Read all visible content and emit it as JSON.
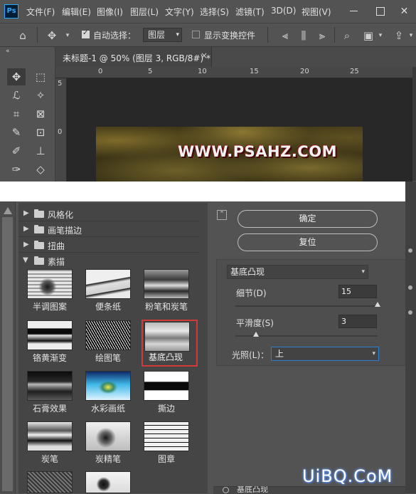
{
  "app": {
    "logo": "Ps"
  },
  "menu": [
    "文件(F)",
    "编辑(E)",
    "图像(I)",
    "图层(L)",
    "文字(Y)",
    "选择(S)",
    "滤镜(T)",
    "3D(D)",
    "视图(V)"
  ],
  "window_controls": {
    "close": "✕"
  },
  "options_bar": {
    "auto_select_label": "自动选择：",
    "auto_select_checked": true,
    "auto_select_target": "图层",
    "show_transform_label": "显示变换控件",
    "show_transform_checked": false
  },
  "document": {
    "tab_title": "未标题-1 @ 50% (图层 3, RGB/8#) *",
    "close": "×",
    "ruler_top": [
      "0",
      "5",
      "10",
      "15",
      "20",
      "25"
    ],
    "ruler_left": [
      "5",
      "0"
    ],
    "canvas_text": "WWW.PSAHZ.COM"
  },
  "filter_gallery": {
    "categories": [
      {
        "label": "风格化",
        "expanded": false
      },
      {
        "label": "画笔描边",
        "expanded": false
      },
      {
        "label": "扭曲",
        "expanded": false
      },
      {
        "label": "素描",
        "expanded": true
      }
    ],
    "thumbnails": [
      {
        "label": "半调图案"
      },
      {
        "label": "便条纸"
      },
      {
        "label": "粉笔和炭笔"
      },
      {
        "label": "铬黄渐变"
      },
      {
        "label": "绘图笔"
      },
      {
        "label": "基底凸现",
        "selected": true
      },
      {
        "label": "石膏效果"
      },
      {
        "label": "水彩画纸"
      },
      {
        "label": "撕边"
      },
      {
        "label": "炭笔"
      },
      {
        "label": "炭精笔"
      },
      {
        "label": "图章"
      }
    ],
    "ok_label": "确定",
    "reset_label": "复位",
    "selected_filter": "基底凸现",
    "params": {
      "detail_label": "细节(D)",
      "detail_value": "15",
      "detail_max": 15,
      "smoothness_label": "平滑度(S)",
      "smoothness_value": "3",
      "smoothness_max": 15,
      "light_label": "光照(L)：",
      "light_value": "上"
    },
    "effect_layer_label": "基底凸现"
  },
  "watermark": "UiBQ.CoM",
  "colors": {
    "accent": "#2f7cd0",
    "highlight": "#d23a3a",
    "panel": "#535353"
  }
}
